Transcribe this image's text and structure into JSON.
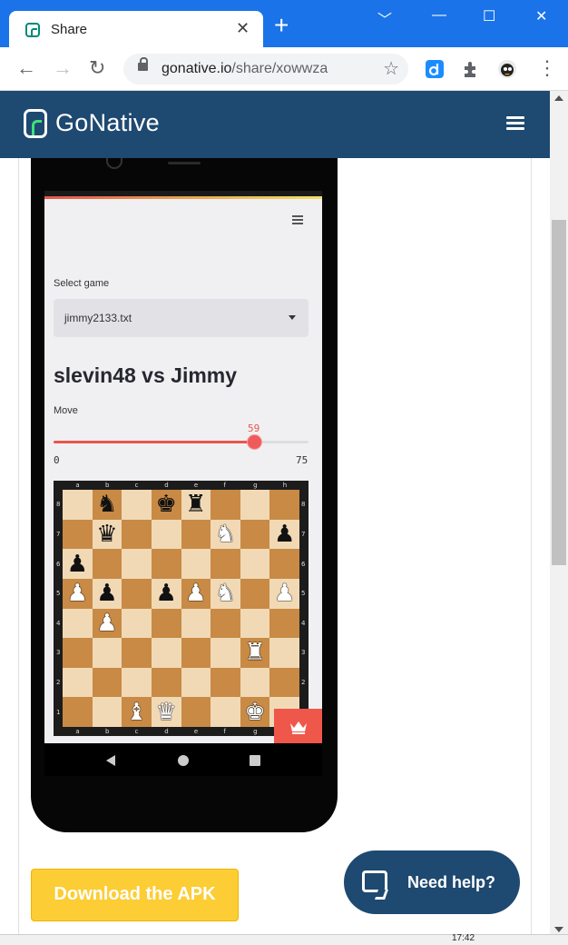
{
  "browser": {
    "tab_title": "Share",
    "tab_close": "✕",
    "new_tab": "+",
    "url_host": "gonative.io",
    "url_path": "/share/xowwza",
    "window_controls": {
      "menu": "﹀",
      "minimize": "—",
      "maximize": "☐",
      "close": "✕"
    },
    "nav": {
      "back": "←",
      "forward": "→",
      "reload": "↻",
      "bookmark": "☆",
      "menu": "⋮"
    }
  },
  "site_header": {
    "logo_text": "GoNative"
  },
  "app": {
    "select_label": "Select game",
    "select_value": "jimmy2133.txt",
    "game_title": "slevin48 vs Jimmy",
    "move_label": "Move",
    "slider_value": "59",
    "slider_min": "0",
    "slider_max": "75",
    "slider_fraction": 0.7867
  },
  "chess": {
    "files": [
      "a",
      "b",
      "c",
      "d",
      "e",
      "f",
      "g",
      "h"
    ],
    "ranks": [
      "8",
      "7",
      "6",
      "5",
      "4",
      "3",
      "2",
      "1"
    ],
    "rows": [
      [
        "",
        "bN",
        "",
        "bK",
        "bR",
        "",
        "",
        ""
      ],
      [
        "",
        "bQ",
        "",
        "",
        "",
        "wN",
        "",
        "bP"
      ],
      [
        "bP",
        "",
        "",
        "",
        "",
        "",
        "",
        ""
      ],
      [
        "wP",
        "bP",
        "",
        "bP",
        "wP",
        "wN",
        "",
        "wP"
      ],
      [
        "",
        "wP",
        "",
        "",
        "",
        "",
        "",
        ""
      ],
      [
        "",
        "",
        "",
        "",
        "",
        "",
        "wR",
        ""
      ],
      [
        "",
        "",
        "",
        "",
        "",
        "",
        "",
        ""
      ],
      [
        "",
        "",
        "wB",
        "wQ",
        "",
        "",
        "wK",
        ""
      ]
    ],
    "glyphs": {
      "K": "♚",
      "Q": "♛",
      "R": "♜",
      "B": "♝",
      "N": "♞",
      "P": "♟"
    }
  },
  "page": {
    "download_label": "Download the APK",
    "help_label": "Need help?"
  },
  "taskbar": {
    "clock": "17:42"
  }
}
